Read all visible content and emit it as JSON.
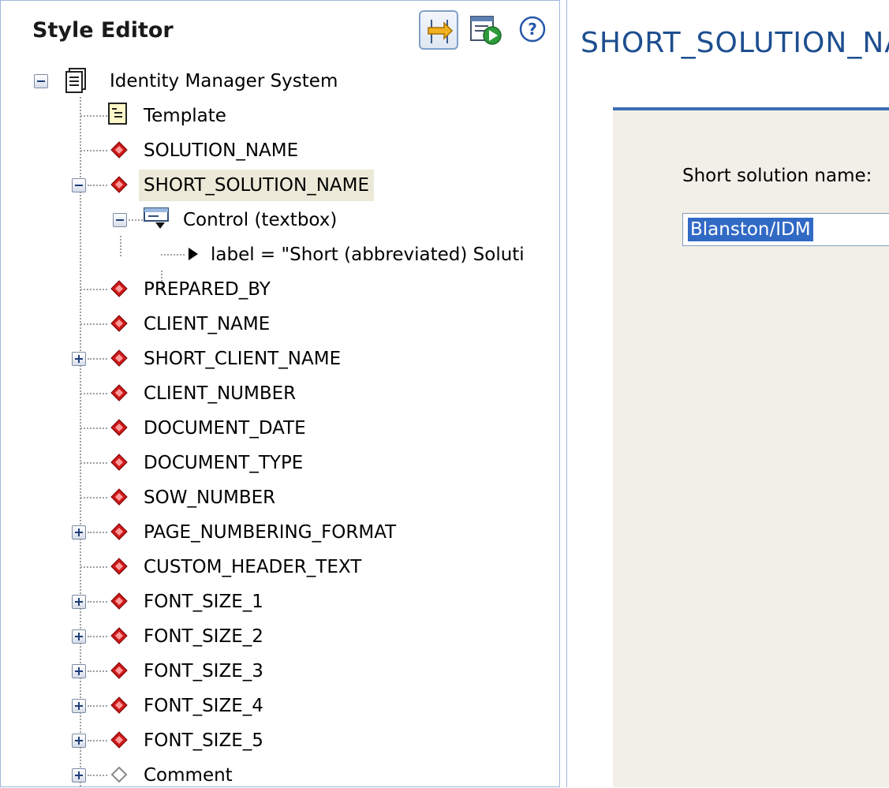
{
  "panel": {
    "title": "Style Editor",
    "toolbar": {
      "toggle_icon": "link-with-editor-icon",
      "run_icon": "preview-run-icon",
      "help_icon": "help-icon"
    }
  },
  "tree": {
    "root": "Identity Manager System",
    "items": [
      {
        "label": "Template"
      },
      {
        "label": "SOLUTION_NAME"
      },
      {
        "label": "SHORT_SOLUTION_NAME"
      },
      {
        "label": "Control (textbox)"
      },
      {
        "label": "label = \"Short (abbreviated) Soluti"
      },
      {
        "label": "PREPARED_BY"
      },
      {
        "label": "CLIENT_NAME"
      },
      {
        "label": "SHORT_CLIENT_NAME"
      },
      {
        "label": "CLIENT_NUMBER"
      },
      {
        "label": "DOCUMENT_DATE"
      },
      {
        "label": "DOCUMENT_TYPE"
      },
      {
        "label": "SOW_NUMBER"
      },
      {
        "label": "PAGE_NUMBERING_FORMAT"
      },
      {
        "label": "CUSTOM_HEADER_TEXT"
      },
      {
        "label": "FONT_SIZE_1"
      },
      {
        "label": "FONT_SIZE_2"
      },
      {
        "label": "FONT_SIZE_3"
      },
      {
        "label": "FONT_SIZE_4"
      },
      {
        "label": "FONT_SIZE_5"
      },
      {
        "label": "Comment"
      }
    ]
  },
  "form": {
    "title": "SHORT_SOLUTION_NAME",
    "field_label": "Short solution name:",
    "field_value": "Blanston/IDM"
  },
  "colors": {
    "accent": "#3c6fb4",
    "selection": "#316ac5",
    "diamond": "#cc1a1a",
    "title": "#1d4e8f"
  }
}
